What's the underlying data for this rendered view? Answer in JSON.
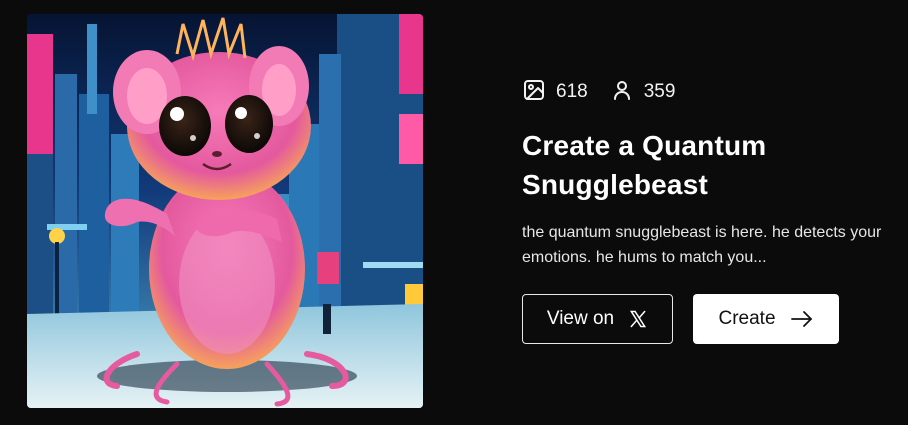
{
  "card": {
    "image_alt": "Pink furry creature standing in a neon futuristic city street",
    "stats": {
      "images_icon": "image-icon",
      "images_count": "618",
      "users_icon": "user-icon",
      "users_count": "359"
    },
    "title": "Create a Quantum Snugglebeast",
    "description": "the quantum snugglebeast is here. he detects your emotions. he hums to match you...",
    "buttons": {
      "view_on_label": "View on",
      "view_on_icon": "x-logo-icon",
      "create_label": "Create",
      "create_icon": "arrow-right-icon"
    }
  },
  "colors": {
    "background": "#0b0b0c",
    "text": "#ffffff",
    "create_button_bg": "#ffffff",
    "create_button_text": "#111111"
  }
}
